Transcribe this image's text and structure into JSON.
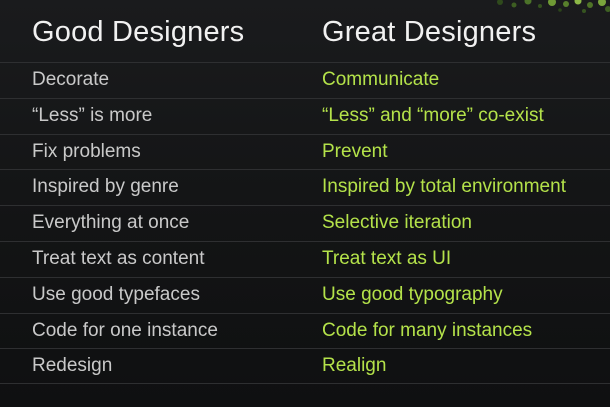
{
  "header": {
    "left": "Good Designers",
    "right": "Great Designers"
  },
  "rows": [
    {
      "good": "Decorate",
      "great": "Communicate"
    },
    {
      "good": "“Less” is more",
      "great": "“Less” and “more” co-exist"
    },
    {
      "good": "Fix problems",
      "great": "Prevent"
    },
    {
      "good": "Inspired by genre",
      "great": "Inspired by total environment"
    },
    {
      "good": "Everything at once",
      "great": "Selective iteration"
    },
    {
      "good": "Treat text as content",
      "great": "Treat text as UI"
    },
    {
      "good": "Use good typefaces",
      "great": "Use good typography"
    },
    {
      "good": "Code for one instance",
      "great": "Code for many instances"
    },
    {
      "good": "Redesign",
      "great": "Realign"
    }
  ],
  "colors": {
    "background": "#131415",
    "heading": "#f1f1f1",
    "good_text": "#c9c9c9",
    "great_text": "#b4e24a",
    "divider": "#2e2f31"
  }
}
